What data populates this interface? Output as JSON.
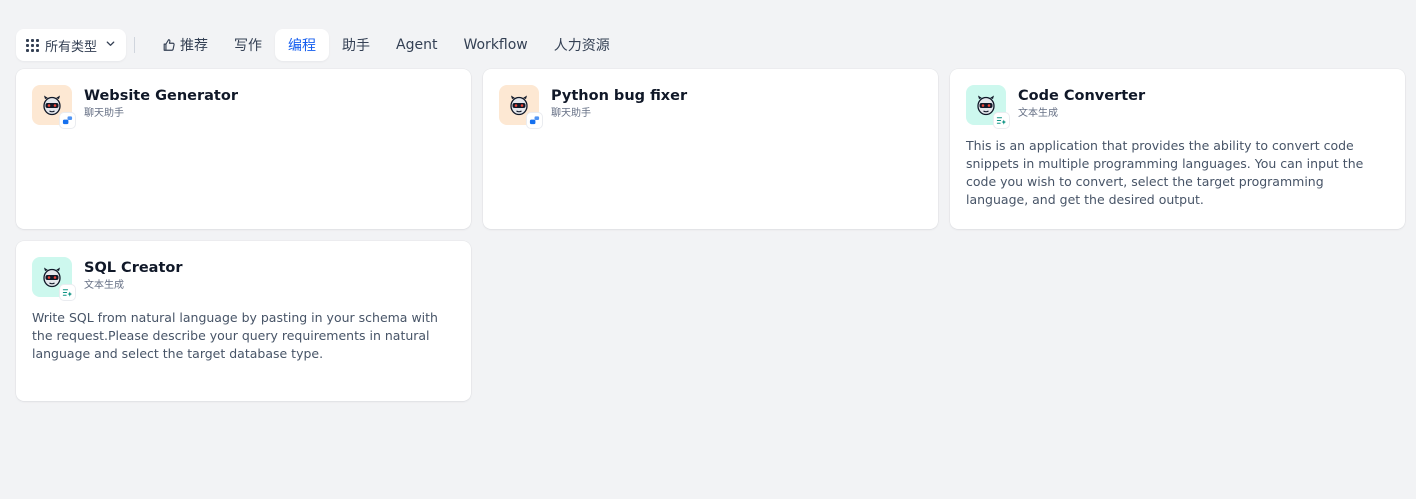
{
  "toolbar": {
    "type_select_label": "所有类型",
    "tabs": [
      {
        "label": "推荐",
        "icon": "thumb-up-icon"
      },
      {
        "label": "写作"
      },
      {
        "label": "编程",
        "active": true
      },
      {
        "label": "助手"
      },
      {
        "label": "Agent"
      },
      {
        "label": "Workflow"
      },
      {
        "label": "人力资源"
      }
    ]
  },
  "colors": {
    "accent": "#155eef",
    "peach_bg": "#fde8d3",
    "mint_bg": "#cdf8ee",
    "chat_badge": "#1570ef",
    "text_badge": "#0e9384"
  },
  "cards": [
    {
      "title": "Website Generator",
      "type": "聊天助手",
      "icon": "robot-face-icon",
      "mode_icon": "chat-bubbles-icon",
      "description": ""
    },
    {
      "title": "Python bug fixer",
      "type": "聊天助手",
      "icon": "robot-face-icon",
      "mode_icon": "chat-bubbles-icon",
      "description": ""
    },
    {
      "title": "Code Converter",
      "type": "文本生成",
      "icon": "robot-face-icon",
      "mode_icon": "text-sparkle-icon",
      "description": "This is an application that provides the ability to convert code snippets in multiple programming languages. You can input the code you wish to convert, select the target programming language, and get the desired output."
    },
    {
      "title": "SQL Creator",
      "type": "文本生成",
      "icon": "robot-face-icon",
      "mode_icon": "text-sparkle-icon",
      "description": "Write SQL from natural language by pasting in your schema with the request.Please describe your query requirements in natural language and select the target database type."
    }
  ]
}
